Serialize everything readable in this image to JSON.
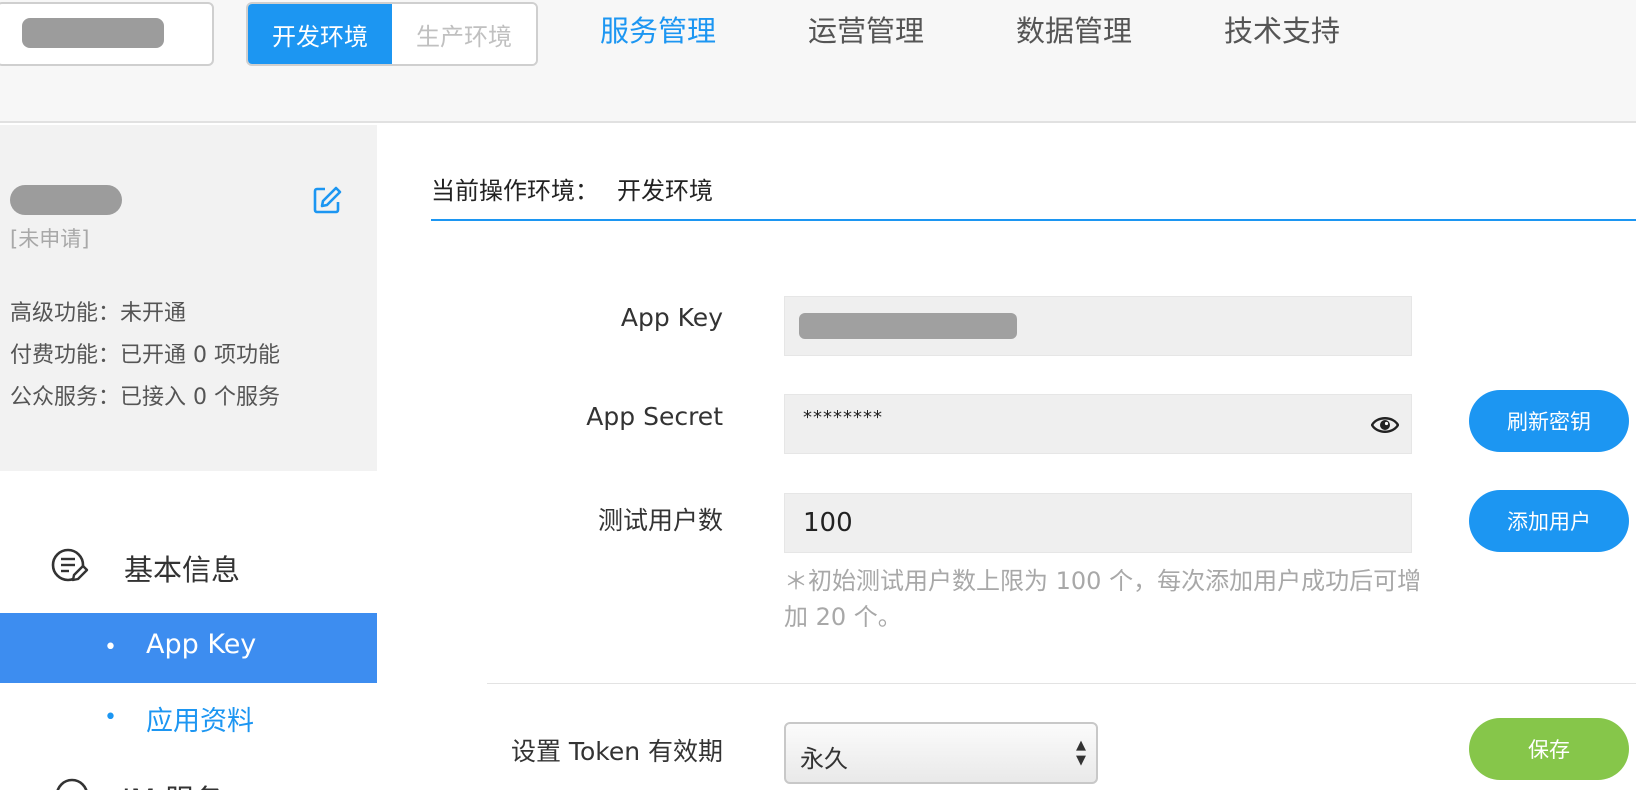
{
  "topbar": {
    "env_toggle": {
      "dev_label": "开发环境",
      "prod_label": "生产环境",
      "active": "dev"
    },
    "nav": [
      {
        "label": "服务管理",
        "active": true
      },
      {
        "label": "运营管理",
        "active": false
      },
      {
        "label": "数据管理",
        "active": false
      },
      {
        "label": "技术支持",
        "active": false
      }
    ]
  },
  "sidebar": {
    "profile": {
      "status": "[未申请]",
      "features": [
        "高级功能：未开通",
        "付费功能：已开通 0 项功能",
        "公众服务：已接入 0 个服务"
      ]
    },
    "menu": {
      "group_label": "基本信息",
      "items": [
        {
          "label": "App Key",
          "active": true
        },
        {
          "label": "应用资料",
          "active": false
        }
      ],
      "next_group_label": "IM 服务"
    }
  },
  "main": {
    "env_title": {
      "label": "当前操作环境：",
      "value": "开发环境"
    },
    "app_key": {
      "label": "App Key"
    },
    "app_secret": {
      "label": "App Secret",
      "value": "********",
      "refresh_button": "刷新密钥"
    },
    "test_users": {
      "label": "测试用户数",
      "value": "100",
      "add_button": "添加用户"
    },
    "hint": "＊初始测试用户数上限为 100 个，每次添加用户成功后可增加 20 个。",
    "token": {
      "label": "设置 Token 有效期",
      "selected": "永久",
      "save_button": "保存"
    }
  },
  "colors": {
    "accent": "#1c96f2",
    "menu_active": "#3d8df0",
    "save_green": "#86c64a"
  }
}
